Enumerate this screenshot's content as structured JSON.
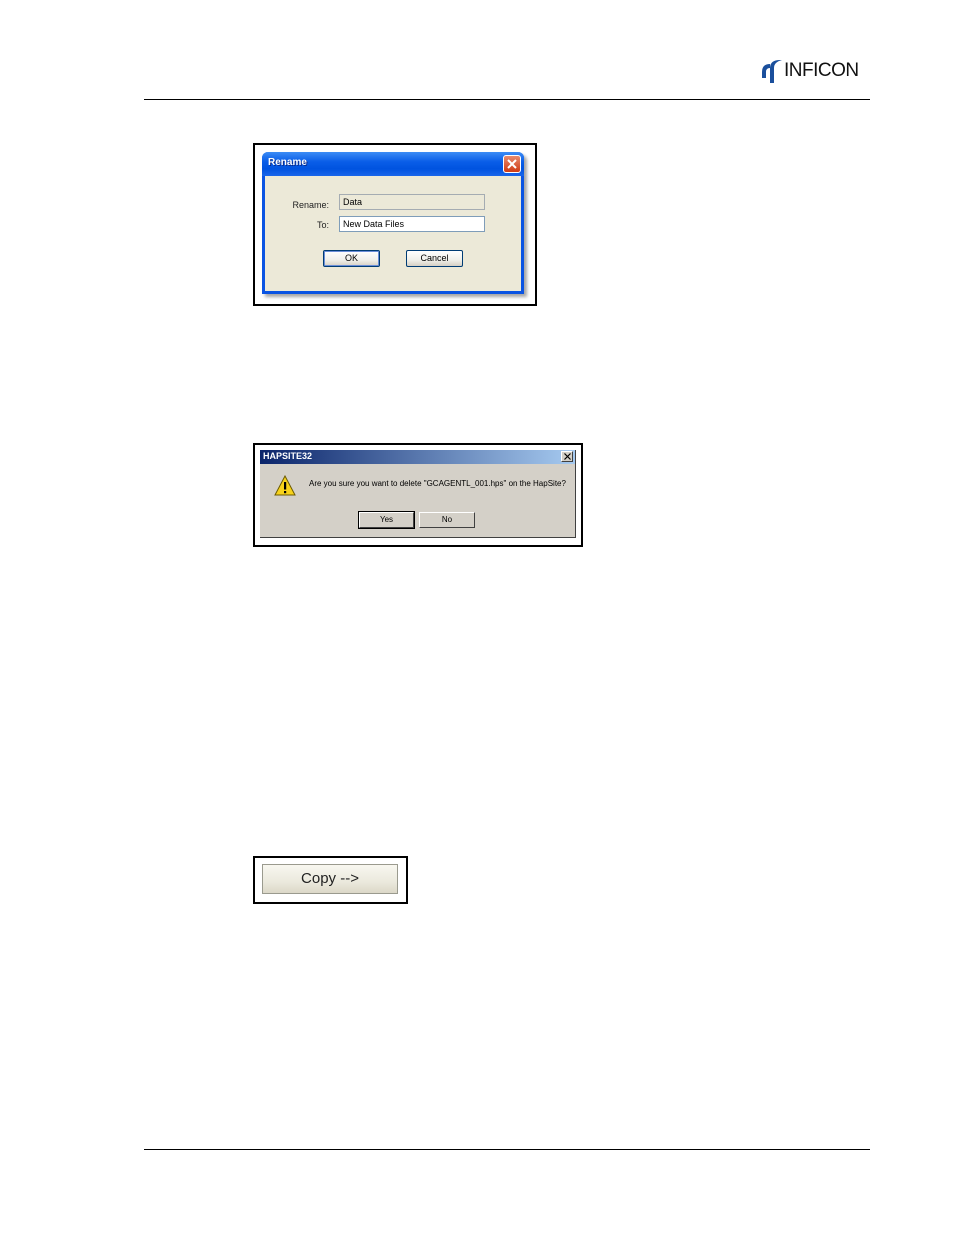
{
  "header": {
    "logo_text": "INFICON"
  },
  "rename_dialog": {
    "title": "Rename",
    "rename_label": "Rename:",
    "rename_value": "Data",
    "to_label": "To:",
    "to_value": "New Data Files",
    "ok_label": "OK",
    "cancel_label": "Cancel"
  },
  "hapsite_dialog": {
    "title": "HAPSITE32",
    "message": "Are you sure you want to delete \"GCAGENTL_001.hps\" on the HapSite?",
    "yes_label": "Yes",
    "no_label": "No",
    "icon": "warning-icon"
  },
  "copy_button": {
    "label": "Copy -->"
  },
  "colors": {
    "xp_title_blue": "#0053e0",
    "xp_close_red": "#cf3a13",
    "dialog_face": "#ece9d8",
    "classic_face": "#d4d0c8",
    "warning_yellow": "#f7d21b"
  }
}
